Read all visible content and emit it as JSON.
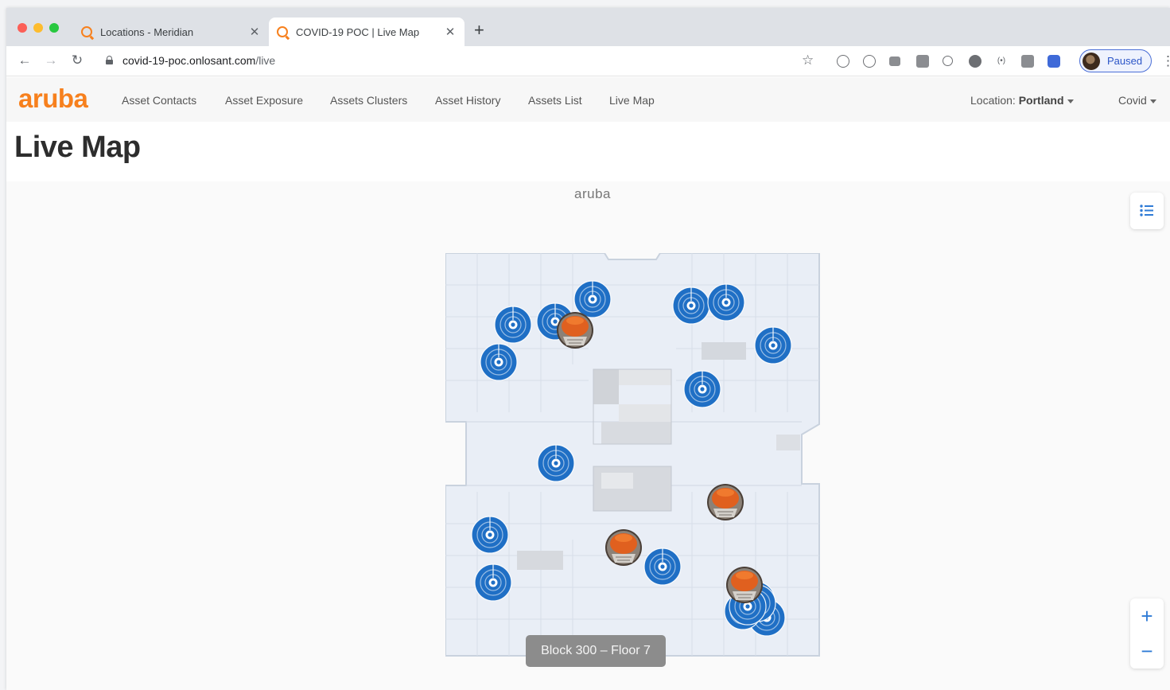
{
  "browser": {
    "tabs": [
      {
        "title": "Locations - Meridian",
        "active": false
      },
      {
        "title": "COVID-19 POC | Live Map",
        "active": true
      }
    ],
    "url_host": "covid-19-poc.onlosant.com",
    "url_path": "/live",
    "profile_label": "Paused"
  },
  "app": {
    "logo": "aruba",
    "nav": [
      "Asset Contacts",
      "Asset Exposure",
      "Assets Clusters",
      "Asset History",
      "Assets List",
      "Live Map"
    ],
    "location_label": "Location:",
    "location_value": "Portland",
    "user_menu": "Covid"
  },
  "page": {
    "title": "Live Map"
  },
  "map": {
    "brand_label": "aruba",
    "floor_label": "Block 300 – Floor 7",
    "accent_color": "#1f6fc5",
    "asset_marker_count": 17,
    "person_marker_count": 4
  }
}
